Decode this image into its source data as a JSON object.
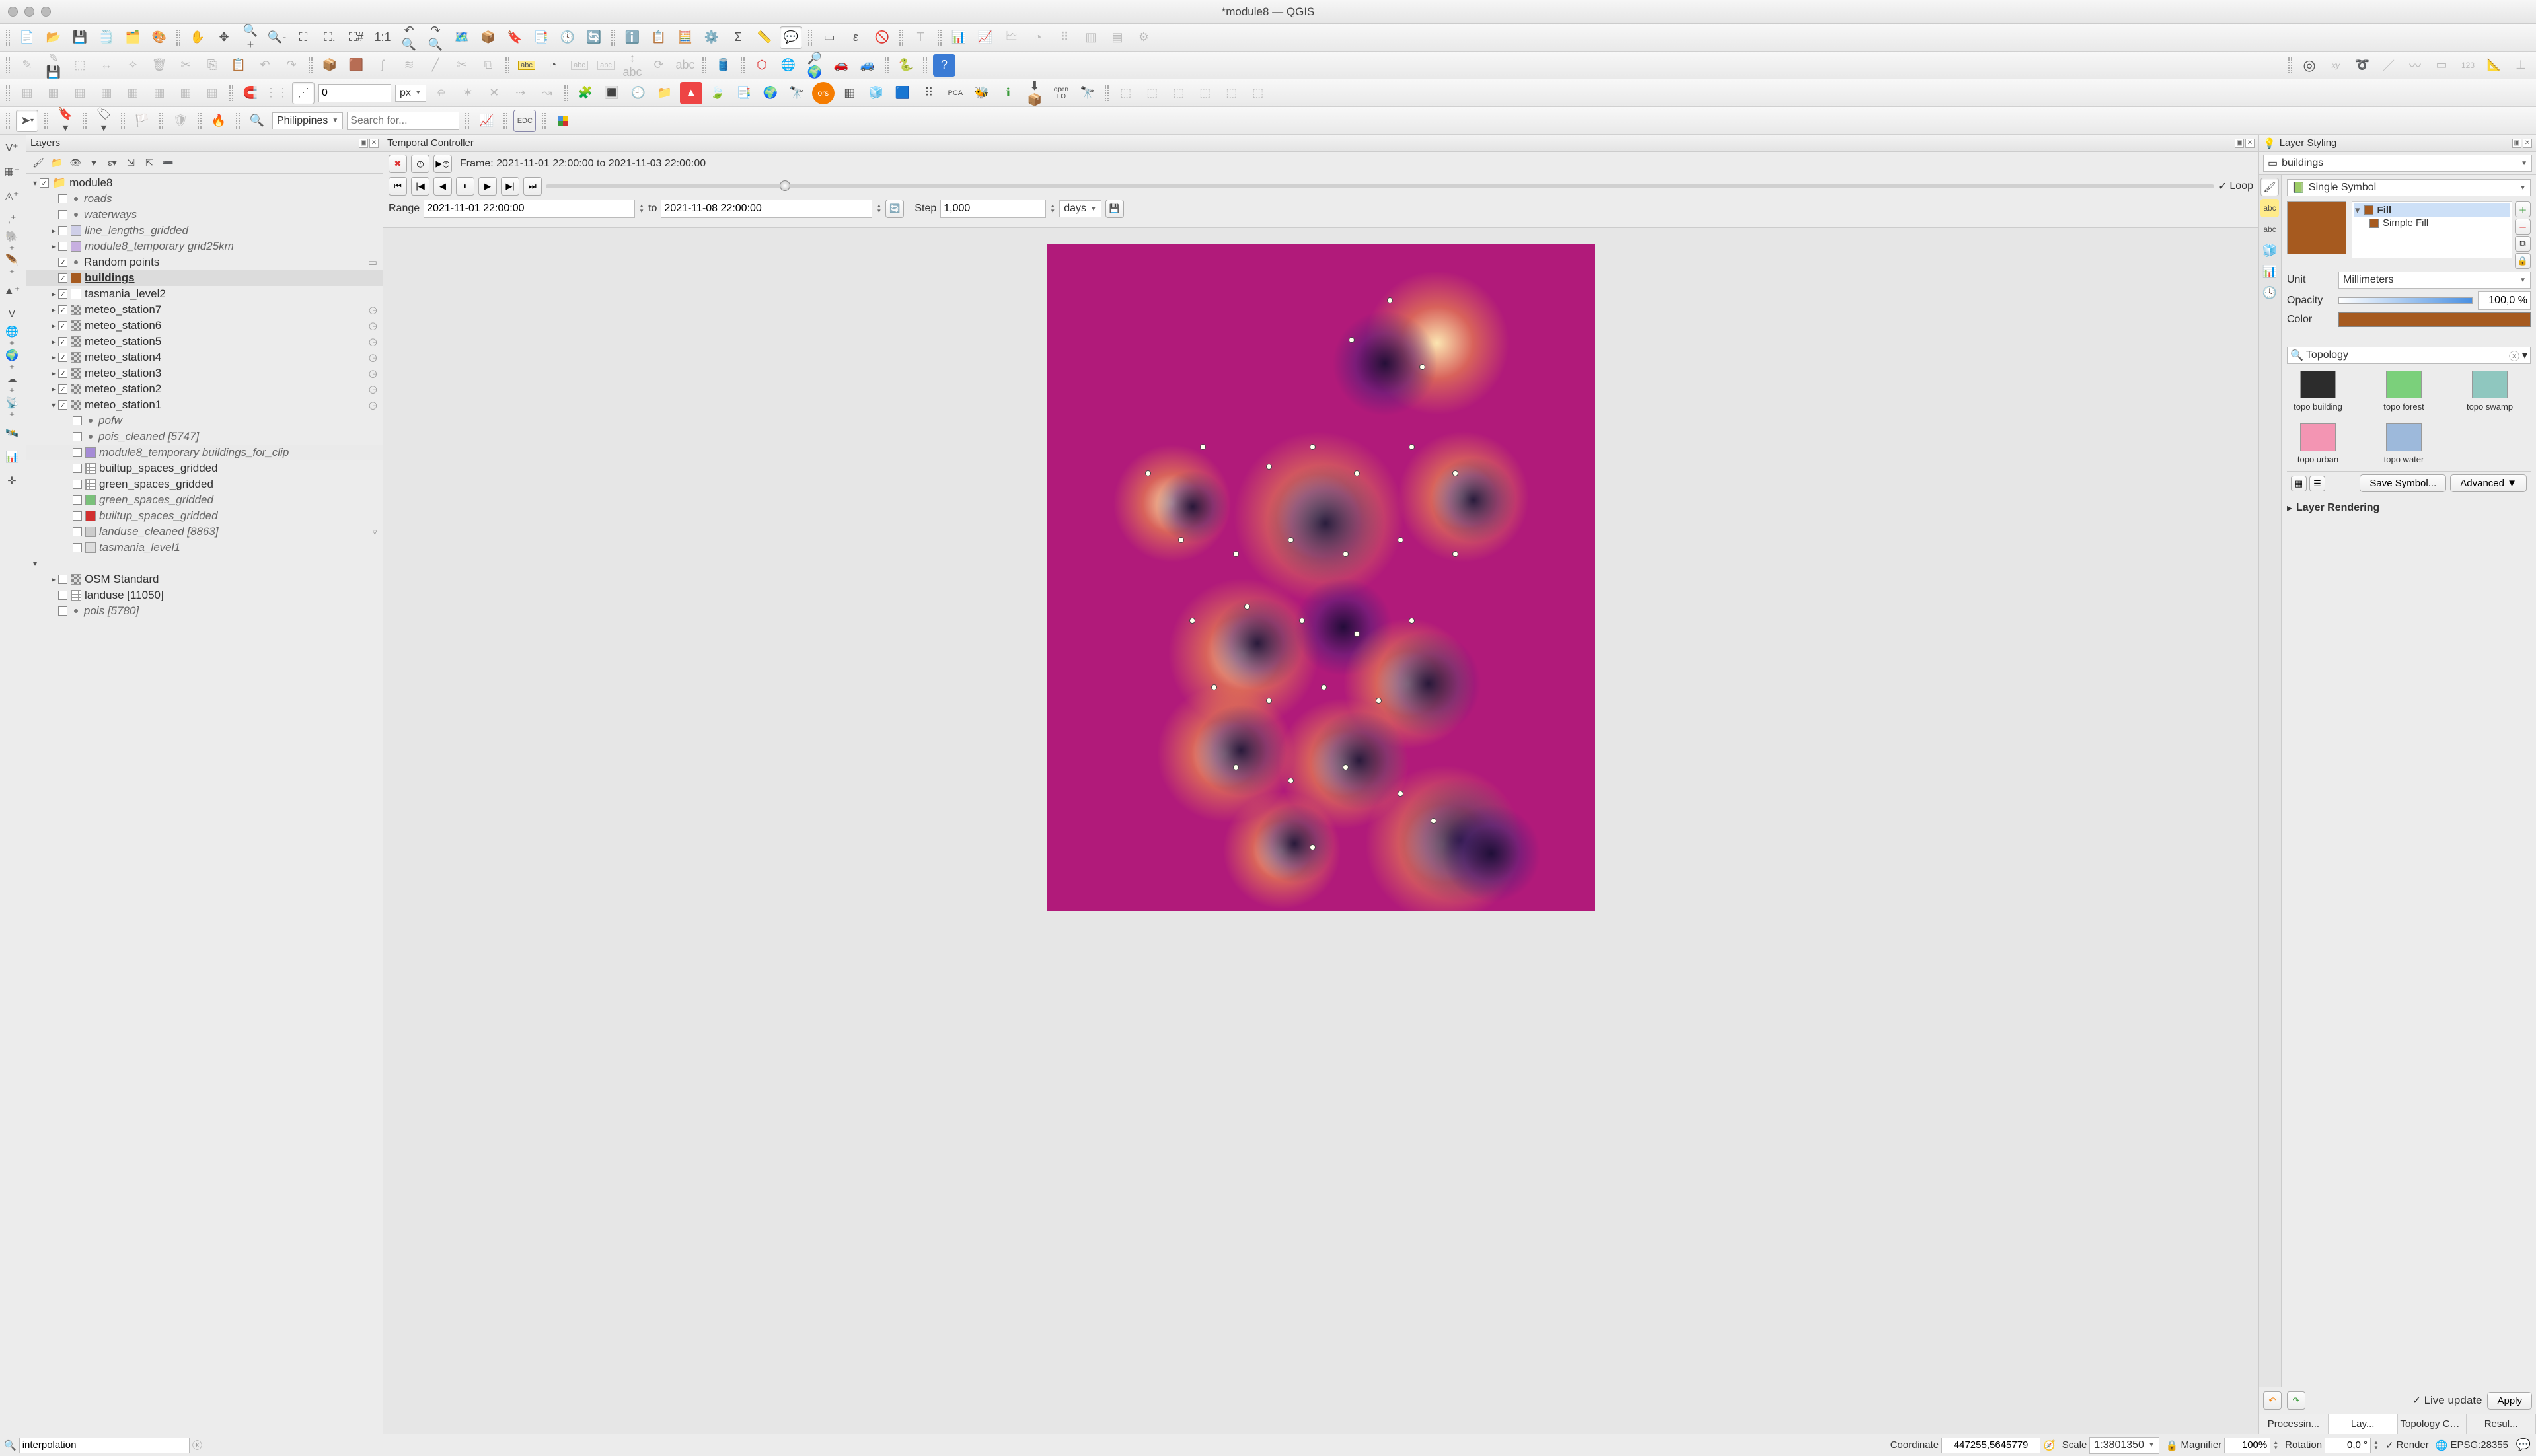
{
  "title": "*module8 — QGIS",
  "toolbar": {
    "zeroInput": "0",
    "unitSelect": "px",
    "regionSelect": "Philippines",
    "searchPlaceholder": "Search for..."
  },
  "layers_panel": {
    "title": "Layers",
    "root": {
      "name": "module8",
      "checked": true,
      "expanded": true
    },
    "items": [
      {
        "name": "roads",
        "checked": false,
        "italic": true,
        "swatch": null,
        "indent": 1,
        "dot": true
      },
      {
        "name": "waterways",
        "checked": false,
        "italic": true,
        "swatch": null,
        "indent": 1,
        "dot": true
      },
      {
        "name": "line_lengths_gridded",
        "checked": false,
        "italic": true,
        "swatch": "#cfcfe8",
        "indent": 1,
        "arrow": true
      },
      {
        "name": "module8_temporary grid25km",
        "checked": false,
        "italic": true,
        "swatch": "#c7afe0",
        "indent": 1,
        "arrow": true
      },
      {
        "name": "Random points",
        "checked": true,
        "italic": false,
        "swatch": null,
        "indent": 1,
        "dot": true,
        "rightico": "▭"
      },
      {
        "name": "buildings",
        "checked": true,
        "italic": false,
        "swatch": "#a65a1f",
        "indent": 1,
        "selected": true,
        "bold": true,
        "under": true
      },
      {
        "name": "tasmania_level2",
        "checked": true,
        "italic": false,
        "swatch": "#fff",
        "indent": 1,
        "arrow": true
      },
      {
        "name": "meteo_station7",
        "checked": true,
        "italic": false,
        "swatch": "checker",
        "indent": 1,
        "arrow": true,
        "rightico": "◷"
      },
      {
        "name": "meteo_station6",
        "checked": true,
        "italic": false,
        "swatch": "checker",
        "indent": 1,
        "arrow": true,
        "rightico": "◷"
      },
      {
        "name": "meteo_station5",
        "checked": true,
        "italic": false,
        "swatch": "checker",
        "indent": 1,
        "arrow": true,
        "rightico": "◷"
      },
      {
        "name": "meteo_station4",
        "checked": true,
        "italic": false,
        "swatch": "checker",
        "indent": 1,
        "arrow": true,
        "rightico": "◷"
      },
      {
        "name": "meteo_station3",
        "checked": true,
        "italic": false,
        "swatch": "checker",
        "indent": 1,
        "arrow": true,
        "rightico": "◷"
      },
      {
        "name": "meteo_station2",
        "checked": true,
        "italic": false,
        "swatch": "checker",
        "indent": 1,
        "arrow": true,
        "rightico": "◷"
      },
      {
        "name": "meteo_station1",
        "checked": true,
        "italic": false,
        "swatch": "checker",
        "indent": 1,
        "arrow": true,
        "rightico": "◷",
        "expand": true
      },
      {
        "name": "pofw",
        "checked": false,
        "italic": true,
        "swatch": null,
        "indent": 2,
        "dot": true
      },
      {
        "name": "pois_cleaned [5747]",
        "checked": false,
        "italic": true,
        "swatch": null,
        "indent": 2,
        "dot": true
      },
      {
        "name": "module8_temporary buildings_for_clip",
        "checked": false,
        "italic": true,
        "swatch": "#a58bd6",
        "indent": 2,
        "highlight": true
      },
      {
        "name": "builtup_spaces_gridded",
        "checked": false,
        "italic": false,
        "swatch": "grid",
        "indent": 2
      },
      {
        "name": "green_spaces_gridded",
        "checked": false,
        "italic": false,
        "swatch": "grid",
        "indent": 2
      },
      {
        "name": "green_spaces_gridded",
        "checked": false,
        "italic": true,
        "swatch": "#7ac07a",
        "indent": 2
      },
      {
        "name": "builtup_spaces_gridded",
        "checked": false,
        "italic": true,
        "swatch": "#d23030",
        "indent": 2
      },
      {
        "name": "landuse_cleaned [8863]",
        "checked": false,
        "italic": true,
        "swatch": "#ccc",
        "indent": 2,
        "rightico": "▿"
      },
      {
        "name": "tasmania_level1",
        "checked": false,
        "italic": true,
        "swatch": "#ddd",
        "indent": 2
      }
    ],
    "second_group": [
      {
        "name": "OSM Standard",
        "checked": false,
        "swatch": "checker",
        "arrow": true
      },
      {
        "name": "landuse [11050]",
        "checked": false,
        "swatch": "grid"
      },
      {
        "name": "pois [5780]",
        "checked": false,
        "italic": true,
        "dot": true
      }
    ]
  },
  "temporal": {
    "title": "Temporal Controller",
    "frameLabel": "Frame: 2021-11-01 22:00:00 to 2021-11-03 22:00:00",
    "rangeLabel": "Range",
    "rangeStart": "2021-11-01 22:00:00",
    "toLabel": "to",
    "rangeEnd": "2021-11-08 22:00:00",
    "stepLabel": "Step",
    "stepValue": "1,000",
    "stepUnit": "days",
    "loop": "Loop"
  },
  "styling": {
    "title": "Layer Styling",
    "layerSelect": "buildings",
    "symbolType": "Single Symbol",
    "fillLabel": "Fill",
    "simpleFill": "Simple Fill",
    "unitLabel": "Unit",
    "unitValue": "Millimeters",
    "opacityLabel": "Opacity",
    "opacityValue": "100,0 %",
    "colorLabel": "Color",
    "searchValue": "Topology",
    "symbols": [
      {
        "name": "topo building",
        "color": "#2c2c2c"
      },
      {
        "name": "topo forest",
        "color": "#7bd07b"
      },
      {
        "name": "topo swamp",
        "color": "#8fc7bf"
      },
      {
        "name": "topo urban",
        "color": "#f395b3"
      },
      {
        "name": "topo water",
        "color": "#9db9db"
      }
    ],
    "saveSymbol": "Save Symbol...",
    "advanced": "Advanced",
    "layerRendering": "Layer Rendering",
    "liveUpdate": "Live update",
    "apply": "Apply",
    "tabs": [
      "Processin...",
      "Lay...",
      "Topology Che...",
      "Resul..."
    ]
  },
  "statusbar": {
    "searchValue": "interpolation",
    "coordLabel": "Coordinate",
    "coordValue": "447255,5645779",
    "scaleLabel": "Scale",
    "scaleValue": "1:3801350",
    "magLabel": "Magnifier",
    "magValue": "100%",
    "rotLabel": "Rotation",
    "rotValue": "0,0 °",
    "renderLabel": "Render",
    "crs": "EPSG:28355"
  }
}
